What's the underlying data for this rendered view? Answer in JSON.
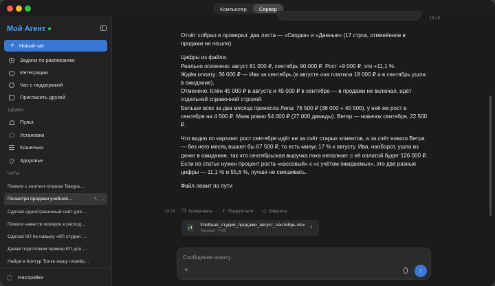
{
  "window": {
    "tabs": [
      {
        "label": "Компьютер",
        "active": false
      },
      {
        "label": "Сервер",
        "active": true
      }
    ]
  },
  "sidebar": {
    "brand": "Мой Агент",
    "new_chat": "Новый чат",
    "items": [
      {
        "label": "Задачи по расписанию",
        "icon": "clock-icon"
      },
      {
        "label": "Интеграции",
        "icon": "plug-icon"
      },
      {
        "label": "Чат с поддержкой",
        "icon": "chat-bubble-icon"
      },
      {
        "label": "Пригласить друзей",
        "icon": "people-icon"
      }
    ],
    "admin_label": "АДМИН",
    "admin_items": [
      {
        "label": "Пульт",
        "icon": "pulse-icon"
      },
      {
        "label": "Установки",
        "icon": "gear-icon"
      },
      {
        "label": "Кошельки",
        "icon": "wallet-icon"
      },
      {
        "label": "Здоровье",
        "icon": "heart-icon"
      }
    ],
    "chats_label": "ЧАТЫ",
    "chats": [
      "Помоги с контент-планом Telegra…",
      "Посмотри продажи учебной…",
      "Сделай одностраничный сайт для …",
      "Помоги навести порядок в расход…",
      "Сделай КП по навыку «КП студии …",
      "Давай подготовим пример КП для …",
      "Найди в Контур Толке нашу планёр…"
    ],
    "settings": "Настройки"
  },
  "conversation": {
    "paragraphs": [
      [
        "Отчёт собрал и проверил: два листа — «Сводка» и «Данные» (17 строк, отменённое в продажи не пошло)."
      ],
      [
        "Цифры из файла:",
        "Реально оплачено: август 81 000 ₽, сентябрь 90 000 ₽. Рост +9 000 ₽, это +11,1 %.",
        "Ждём оплату: 36 000 ₽ — Ива за сентябрь (в августе она платила 18 000 ₽ и в сентябрь ушла в ожидание).",
        "Отменено: Клён 45 000 ₽ в августе и 45 000 ₽ в сентябре — в продажи не включал, идёт отдельной справочной строкой.",
        "Больше всех за два месяца принесла Липа: 76 500 ₽ (36 000 + 40 500), у неё же рост в сентябре на 4 500 ₽. Маяк ровно 54 000 ₽ (27 000 дважды). Ветер — новичок сентября, 22 500 ₽."
      ],
      [
        "Что видно по картине: рост сентября идёт не за счёт старых клиентов, а за счёт нового Ветра — без него месяц вышел бы 67 500 ₽, то есть минус 17 % к августу. Ива, наоборот, ушла из денег в ожидание, так что сентябрьская выручка пока неполная: с её оплатой будет 126 000 ₽.",
        "Если по статье нужен процент роста «кассовый» к «с учётом ожидаемых», это две разные цифры — 11,1 % и 55,6 %, лучше не смешивать."
      ],
      [
        "Файл лежит по пути"
      ]
    ],
    "time_prev": "19:19",
    "time": "19:19",
    "actions": {
      "copy": "Копировать",
      "share": "Поделиться",
      "speak": "Озвучить"
    },
    "file": {
      "name": "Учебная_студия_продажи_август_сентябрь.xlsx",
      "meta": "Таблица · 7 КБ"
    }
  },
  "composer": {
    "placeholder": "Сообщение агенту..."
  }
}
